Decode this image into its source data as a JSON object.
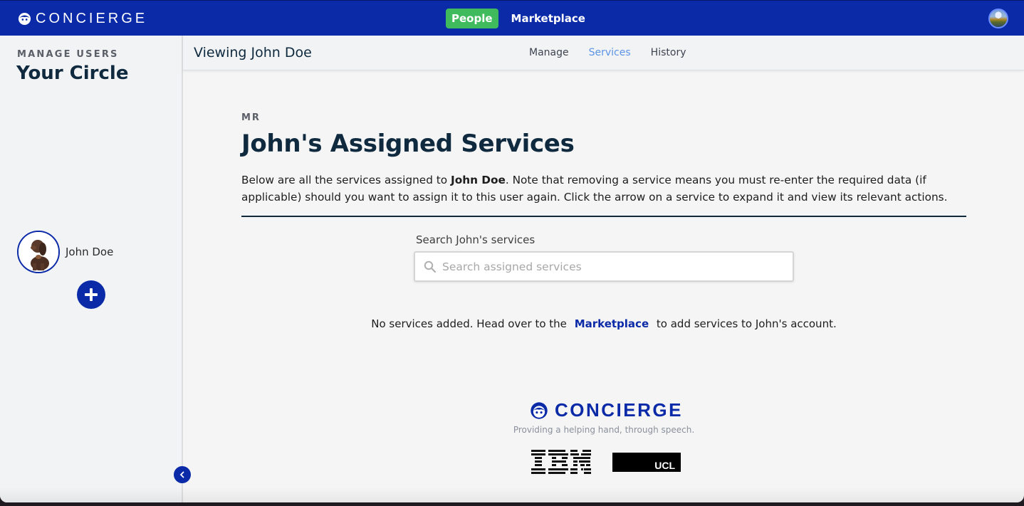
{
  "topbar": {
    "brand": "CONCIERGE",
    "nav": [
      {
        "label": "People",
        "active": true
      },
      {
        "label": "Marketplace",
        "active": false
      }
    ],
    "profile_avatar": "landscape-profile-photo"
  },
  "sidebar": {
    "kicker": "MANAGE USERS",
    "title": "Your Circle",
    "users": [
      {
        "name": "John Doe",
        "avatar": "puppy-photo"
      }
    ],
    "add_icon": "plus-icon",
    "collapse_icon": "chevron-left-icon"
  },
  "subheader": {
    "title": "Viewing John Doe",
    "tabs": [
      {
        "label": "Manage",
        "active": false
      },
      {
        "label": "Services",
        "active": true
      },
      {
        "label": "History",
        "active": false
      }
    ]
  },
  "main": {
    "kicker": "MR",
    "heading": "John's Assigned Services",
    "description_prefix": "Below are all the services assigned to ",
    "description_bold": "John Doe",
    "description_suffix": ". Note that removing a service means you must re-enter the required data (if applicable) should you want to assign it to this user again. Click the arrow on a service to expand it and view its relevant actions.",
    "search": {
      "label": "Search John's services",
      "placeholder": "Search assigned services",
      "value": "",
      "icon": "search-icon"
    },
    "empty_message": {
      "prefix": "No services added. Head over to the",
      "link": "Marketplace",
      "suffix": "to add services to John's account."
    }
  },
  "footer": {
    "brand": "CONCIERGE",
    "tagline": "Providing a helping hand, through speech.",
    "partners": [
      "IBM",
      "UCL"
    ]
  },
  "colors": {
    "brand_blue": "#0a2aa8",
    "active_green": "#3fba5c",
    "active_tab": "#5c93e6",
    "heading_navy": "#0f2a3f"
  }
}
